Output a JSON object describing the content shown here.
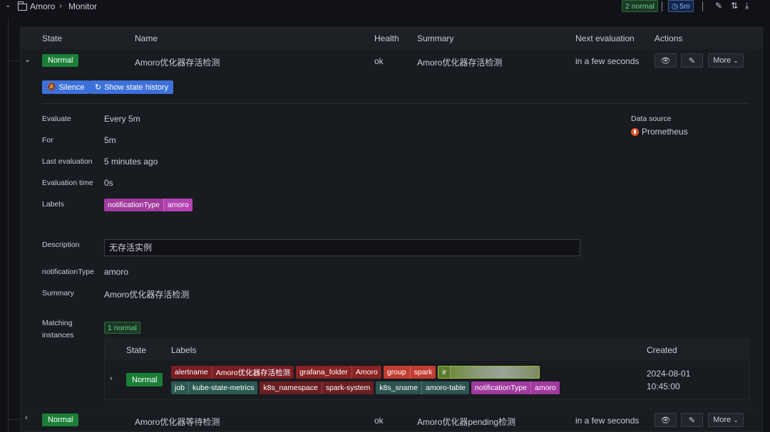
{
  "breadcrumb": {
    "folder": "Amoro",
    "separator": "›",
    "page": "Monitor"
  },
  "topbar": {
    "normal_count": "2 normal",
    "interval": "5m"
  },
  "table": {
    "headers": [
      "State",
      "Name",
      "Health",
      "Summary",
      "Next evaluation",
      "Actions"
    ]
  },
  "rules": [
    {
      "state": "Normal",
      "name": "Amoro优化器存活检测",
      "health": "ok",
      "summary": "Amoro优化器存活检测",
      "next_evaluation": "in a few seconds",
      "more_label": "More"
    },
    {
      "state": "Normal",
      "name": "Amoro优化器等待检测",
      "health": "ok",
      "summary": "Amoro优化器pending检测",
      "next_evaluation": "in a few seconds",
      "more_label": "More"
    }
  ],
  "details": {
    "silence_label": "Silence",
    "history_label": "Show state history",
    "evaluate_label": "Evaluate",
    "evaluate_value": "Every 5m",
    "for_label": "For",
    "for_value": "5m",
    "last_eval_label": "Last evaluation",
    "last_eval_value": "5 minutes ago",
    "eval_time_label": "Evaluation time",
    "eval_time_value": "0s",
    "labels_label": "Labels",
    "label_key": "notificationType",
    "label_value": "amoro",
    "datasource_label": "Data source",
    "datasource_value": "Prometheus",
    "description_label": "Description",
    "description_value": "无存活实例",
    "notification_label": "notificationType",
    "notification_value": "amoro",
    "summary_label": "Summary",
    "summary_value": "Amoro优化器存活检测",
    "matching_label_1": "Matching",
    "matching_label_2": "instances",
    "matching_count": "1 normal"
  },
  "instances": {
    "headers": [
      "State",
      "Labels",
      "Created"
    ],
    "row": {
      "state": "Normal",
      "created_date": "2024-08-01",
      "created_time": "10:45:00",
      "labels": [
        {
          "key": "alertname",
          "value": "Amoro优化器存活检测",
          "color": "#7a1d24"
        },
        {
          "key": "grafana_folder",
          "value": "Amoro",
          "color": "#8a2323"
        },
        {
          "key": "group",
          "value": "spark",
          "color": "#c23d31"
        },
        {
          "key": "ir",
          "value": "",
          "color": "#5c7a2c"
        },
        {
          "key": "job",
          "value": "kube-state-metrics",
          "color": "#2b5a52"
        },
        {
          "key": "k8s_namespace",
          "value": "spark-system",
          "color": "#6b1f24"
        },
        {
          "key": "k8s_sname",
          "value": "amoro-table",
          "color": "#2e5451"
        },
        {
          "key": "notificationType",
          "value": "amoro",
          "color": "#a23aa0"
        }
      ]
    }
  }
}
